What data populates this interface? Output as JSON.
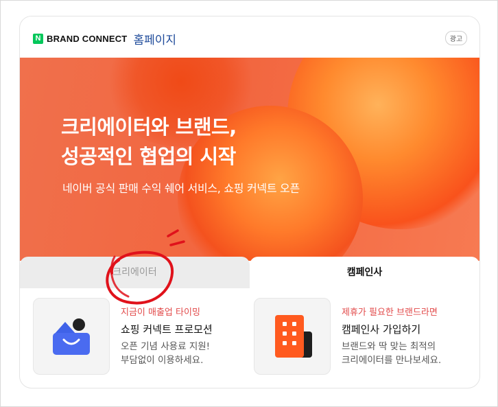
{
  "header": {
    "logo_mark": "N",
    "brand": "BRAND CONNECT",
    "page": "홈페이지",
    "ad_badge": "광고"
  },
  "banner": {
    "title_line1": "크리에이터와 브랜드,",
    "title_line2": "성공적인 협업의 시작",
    "subtitle": "네이버 공식 판매 수익 쉐어 서비스, 쇼핑 커넥트 오픈"
  },
  "tabs": [
    {
      "label": "크리에이터",
      "active": false
    },
    {
      "label": "캠페인사",
      "active": true
    }
  ],
  "promos": [
    {
      "eyebrow": "지금이 매출업 타이밍",
      "title": "쇼핑 커넥트 프로모션",
      "desc_line1": "오픈 기념 사용료 지원!",
      "desc_line2": "부담없이 이용하세요.",
      "icon": "shopping-bag-icon"
    },
    {
      "eyebrow": "제휴가 필요한 브랜드라면",
      "title": "캠페인사 가입하기",
      "desc_line1": "브랜드와 딱 맞는 최적의",
      "desc_line2": "크리에이터를 만나보세요.",
      "icon": "building-icon"
    }
  ],
  "colors": {
    "naver_green": "#03c75a",
    "banner_orange": "#f2663f",
    "eyebrow_red": "#e24a4a",
    "annotation_red": "#e0121b",
    "brand_blue": "#1e4a9a"
  }
}
